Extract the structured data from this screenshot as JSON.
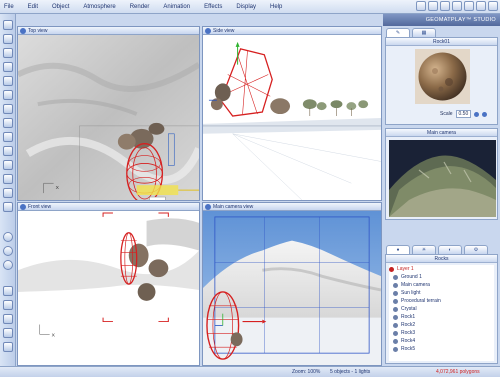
{
  "menu": [
    "File",
    "Edit",
    "Object",
    "Atmosphere",
    "Render",
    "Animation",
    "Effects",
    "Display",
    "Help"
  ],
  "viewports": {
    "top": "Top view",
    "side": "Side view",
    "front": "Front view",
    "main": "Main camera view"
  },
  "brand": "GEOMATPLAY™ STUDIO",
  "material_panel": {
    "title": "Rock01",
    "scale_label": "Scale",
    "scale_value": "0.50"
  },
  "preview_panel": {
    "title": "Main camera"
  },
  "layers_panel": {
    "title": "Rocks",
    "items": [
      "Layer 1",
      "Ground 1",
      "Main camera",
      "Sun light",
      "Procedural terrain",
      "Crystal",
      "Rock1",
      "Rock2",
      "Rock3",
      "Rock4",
      "Rock5"
    ]
  },
  "status": {
    "zoom": "Zoom: 100%",
    "objects": "5 objects - 1 lights",
    "polygons": "4,072,961 polygons"
  },
  "colors": {
    "accent": "#4a72c4",
    "wire": "#d62020",
    "selected_text": "#c42222"
  }
}
